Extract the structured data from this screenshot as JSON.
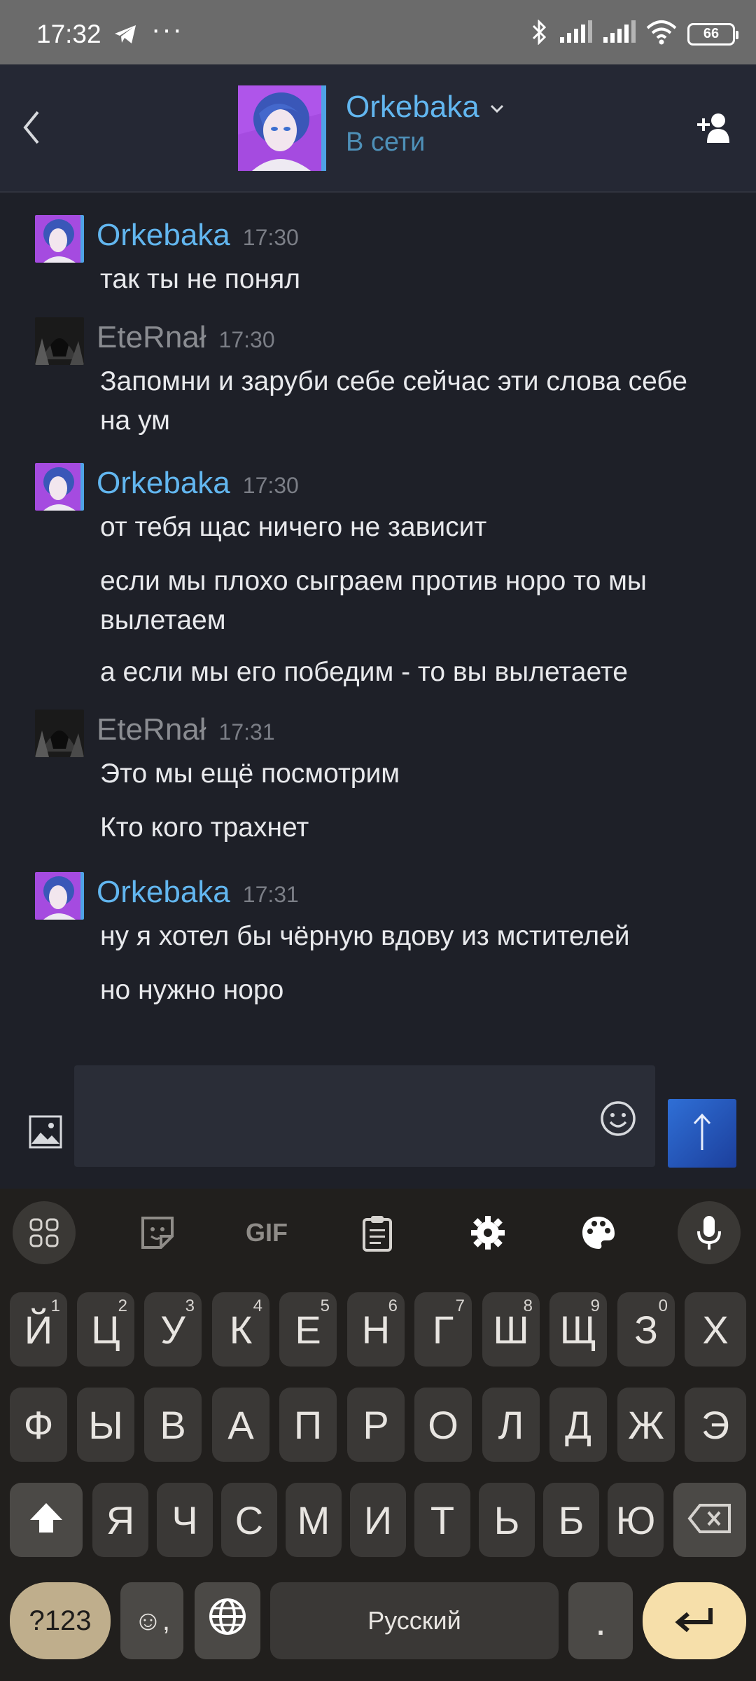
{
  "status_bar": {
    "time": "17:32",
    "more": "···",
    "battery": "66",
    "icons": [
      "telegram-icon",
      "bluetooth-icon",
      "signal-icon",
      "signal-icon",
      "wifi-icon",
      "battery-icon"
    ]
  },
  "header": {
    "name": "Orkebaka",
    "status": "В сети",
    "accent": "#62b6ef"
  },
  "messages": [
    {
      "author": "Orkebaka",
      "time": "17:30",
      "lines": [
        "так ты не понял"
      ]
    },
    {
      "author": "EteRnał",
      "time": "17:30",
      "lines": [
        "Запомни и заруби себе сейчас эти слова себе на ум"
      ]
    },
    {
      "author": "Orkebaka",
      "time": "17:30",
      "lines": [
        "от тебя щас ничего не зависит",
        "если мы плохо сыграем против норо то мы вылетаем",
        "а если мы его победим - то вы вылетаете"
      ]
    },
    {
      "author": "EteRnał",
      "time": "17:31",
      "lines": [
        "Это мы ещё посмотрим",
        "Кто кого трахнет"
      ]
    },
    {
      "author": "Orkebaka",
      "time": "17:31",
      "lines": [
        "ну я хотел бы чёрную вдову из мстителей",
        "но нужно норо"
      ]
    }
  ],
  "input": {
    "placeholder": ""
  },
  "keyboard": {
    "toolbar_gif": "GIF",
    "row1": [
      {
        "k": "Й",
        "n": "1"
      },
      {
        "k": "Ц",
        "n": "2"
      },
      {
        "k": "У",
        "n": "3"
      },
      {
        "k": "К",
        "n": "4"
      },
      {
        "k": "Е",
        "n": "5"
      },
      {
        "k": "Н",
        "n": "6"
      },
      {
        "k": "Г",
        "n": "7"
      },
      {
        "k": "Ш",
        "n": "8"
      },
      {
        "k": "Щ",
        "n": "9"
      },
      {
        "k": "З",
        "n": "0"
      },
      {
        "k": "Х",
        "n": ""
      }
    ],
    "row2": [
      "Ф",
      "Ы",
      "В",
      "А",
      "П",
      "Р",
      "О",
      "Л",
      "Д",
      "Ж",
      "Э"
    ],
    "row3": [
      "Я",
      "Ч",
      "С",
      "М",
      "И",
      "Т",
      "Ь",
      "Б",
      "Ю"
    ],
    "symbols": "?123",
    "emoji_comma": "☺,",
    "space": "Русский",
    "period": "."
  }
}
